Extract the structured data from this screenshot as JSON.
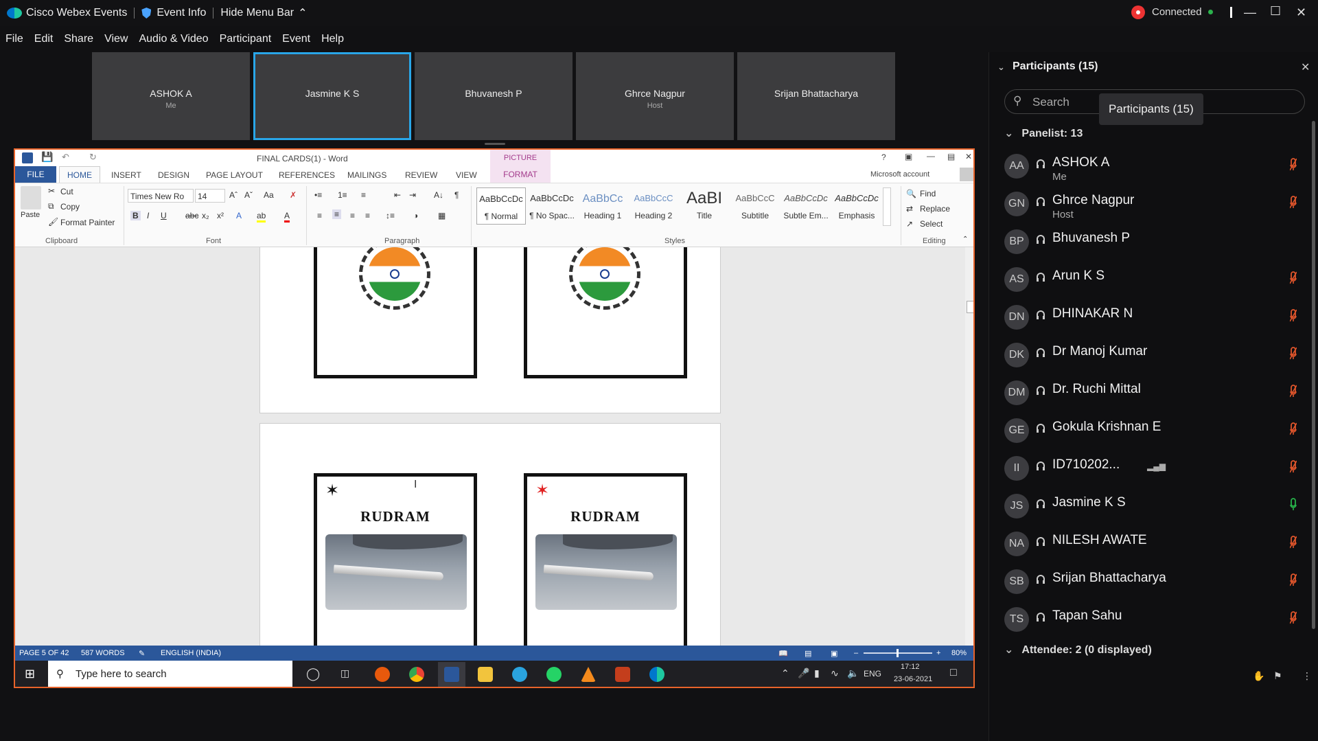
{
  "titlebar": {
    "app_name": "Cisco Webex Events",
    "event_info": "Event Info",
    "hide_menu": "Hide Menu Bar",
    "connection": "Connected"
  },
  "menu": [
    "File",
    "Edit",
    "Share",
    "View",
    "Audio & Video",
    "Participant",
    "Event",
    "Help"
  ],
  "video_tiles": [
    {
      "name": "ASHOK A",
      "sub": "Me"
    },
    {
      "name": "Jasmine K S",
      "sub": ""
    },
    {
      "name": "Bhuvanesh P",
      "sub": ""
    },
    {
      "name": "Ghrce Nagpur",
      "sub": "Host"
    },
    {
      "name": "Srijan Bhattacharya",
      "sub": ""
    }
  ],
  "word": {
    "doc_title": "FINAL CARDS(1) - Word",
    "picture_tools": "PICTURE TOOLS",
    "account": "Microsoft account",
    "tabs": [
      "FILE",
      "HOME",
      "INSERT",
      "DESIGN",
      "PAGE LAYOUT",
      "REFERENCES",
      "MAILINGS",
      "REVIEW",
      "VIEW",
      "FORMAT"
    ],
    "clipboard": {
      "paste": "Paste",
      "cut": "Cut",
      "copy": "Copy",
      "format_painter": "Format Painter",
      "label": "Clipboard"
    },
    "font": {
      "name": "Times New Ro",
      "size": "14",
      "label": "Font"
    },
    "paragraph_label": "Paragraph",
    "styles": [
      {
        "preview": "AaBbCcDc",
        "name": "¶ Normal"
      },
      {
        "preview": "AaBbCcDc",
        "name": "¶ No Spac..."
      },
      {
        "preview": "AaBbCc",
        "name": "Heading 1"
      },
      {
        "preview": "AaBbCcC",
        "name": "Heading 2"
      },
      {
        "preview": "AaBI",
        "name": "Title"
      },
      {
        "preview": "AaBbCcC",
        "name": "Subtitle"
      },
      {
        "preview": "AaBbCcDc",
        "name": "Subtle Em..."
      },
      {
        "preview": "AaBbCcDc",
        "name": "Emphasis"
      }
    ],
    "styles_label": "Styles",
    "editing": {
      "find": "Find",
      "replace": "Replace",
      "select": "Select",
      "label": "Editing"
    },
    "cards": {
      "title1": "RUDRAM",
      "title2": "RUDRAM"
    },
    "status": {
      "page": "PAGE 5 OF 42",
      "words": "587 WORDS",
      "language": "ENGLISH (INDIA)",
      "zoom": "80%"
    }
  },
  "taskbar": {
    "search_placeholder": "Type here to search",
    "lang": "ENG",
    "time": "17:12",
    "date": "23-06-2021"
  },
  "participants": {
    "header": "Participants (15)",
    "tooltip": "Participants (15)",
    "search_placeholder": "Search",
    "panelist_header": "Panelist: 13",
    "attendee_header": "Attendee: 2 (0 displayed)",
    "list": [
      {
        "initials": "AA",
        "name": "ASHOK A",
        "sub": "Me",
        "muted": true
      },
      {
        "initials": "GN",
        "name": "Ghrce Nagpur",
        "sub": "Host",
        "muted": true
      },
      {
        "initials": "BP",
        "name": "Bhuvanesh P",
        "sub": "",
        "muted": false
      },
      {
        "initials": "AS",
        "name": "Arun K S",
        "sub": "",
        "muted": true
      },
      {
        "initials": "DN",
        "name": "DHINAKAR N",
        "sub": "",
        "muted": true
      },
      {
        "initials": "DK",
        "name": "Dr Manoj Kumar",
        "sub": "",
        "muted": true
      },
      {
        "initials": "DM",
        "name": "Dr. Ruchi Mittal",
        "sub": "",
        "muted": true
      },
      {
        "initials": "GE",
        "name": "Gokula Krishnan E",
        "sub": "",
        "muted": true
      },
      {
        "initials": "II",
        "name": "ID710202...",
        "sub": "",
        "muted": true
      },
      {
        "initials": "JS",
        "name": "Jasmine K S",
        "sub": "",
        "muted": false
      },
      {
        "initials": "NA",
        "name": "NILESH AWATE",
        "sub": "",
        "muted": true
      },
      {
        "initials": "SB",
        "name": "Srijan Bhattacharya",
        "sub": "",
        "muted": true
      },
      {
        "initials": "TS",
        "name": "Tapan Sahu",
        "sub": "",
        "muted": true
      }
    ]
  },
  "colors": {
    "accent": "#29a6e8",
    "share_border": "#e8632a",
    "muted": "#e0552b",
    "active_mic": "#27b34a",
    "word_blue": "#2b579a"
  }
}
